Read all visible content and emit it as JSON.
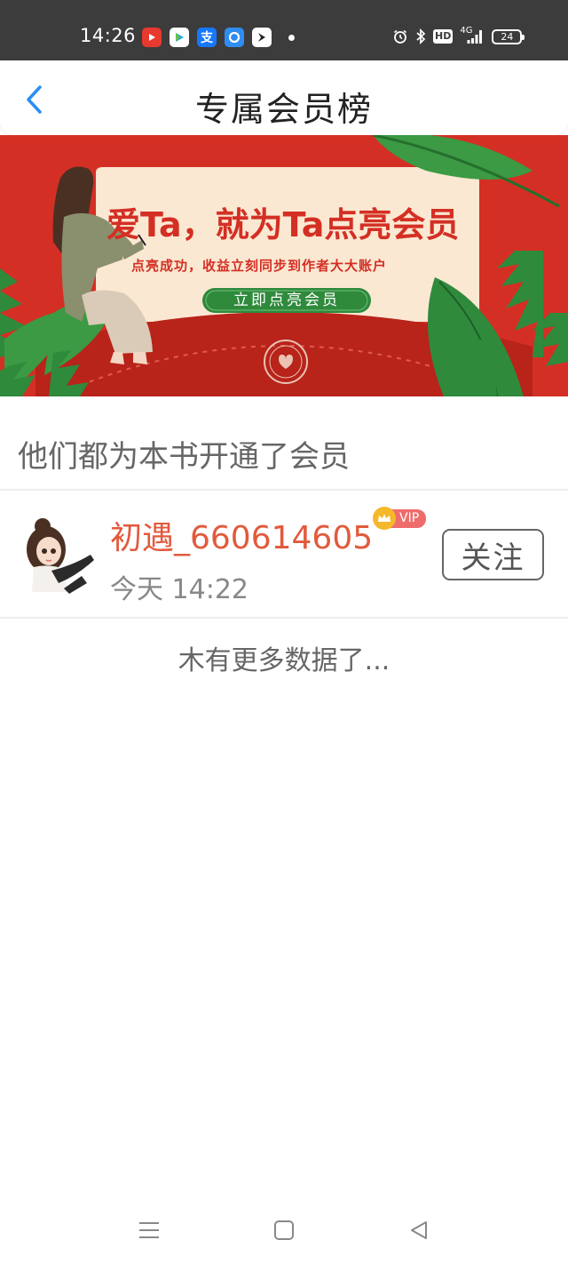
{
  "status_bar": {
    "time": "14:26",
    "network": "4G",
    "battery": "24",
    "hd_label": "HD",
    "app_icons": [
      "video-app-icon",
      "tv-app-icon",
      "alipay-icon",
      "browser-icon",
      "arrow-app-icon"
    ],
    "system_icons": [
      "alarm-icon",
      "bluetooth-icon",
      "hd-icon",
      "signal-icon",
      "battery-icon"
    ]
  },
  "header": {
    "title": "专属会员榜",
    "back_icon": "chevron-left-icon",
    "accent_color": "#2a8ef5"
  },
  "banner": {
    "headline": "爱Ta，就为Ta点亮会员",
    "subline": "点亮成功，收益立刻同步到作者大大账户",
    "cta_label": "立即点亮会员",
    "background_color": "#d42f24",
    "card_color": "#fbe8d2",
    "cta_color": "#2f8a3c"
  },
  "section": {
    "title": "他们都为本书开通了会员"
  },
  "members": [
    {
      "name": "初遇_660614605",
      "badge": "VIP",
      "time": "今天 14:22",
      "follow_label": "关注",
      "name_color": "#e25a3c"
    }
  ],
  "list_footer": "木有更多数据了...",
  "nav_bar": {
    "icons": [
      "menu-icon",
      "home-square-icon",
      "back-triangle-icon"
    ]
  }
}
